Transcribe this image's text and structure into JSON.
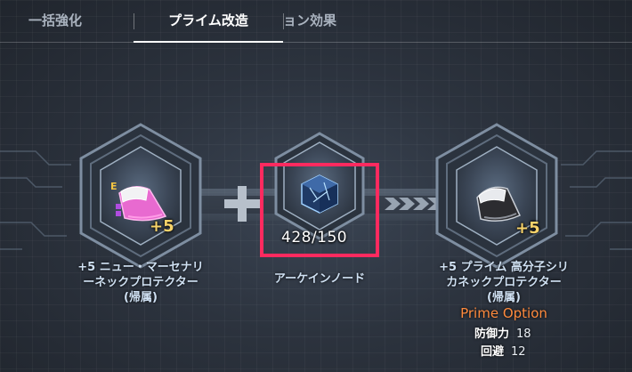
{
  "tabs": [
    {
      "label": "一括強化",
      "active": false
    },
    {
      "label": "プライム改造",
      "active": true
    },
    {
      "label": "ョン効果",
      "active": false
    }
  ],
  "source_item": {
    "plus": "+5",
    "name_lines": [
      "+5 ニュー・マーセナリ",
      "ーネックプロテクター",
      "(帰属)"
    ],
    "grade_letter": "E",
    "icon": "pink-neck-protector-icon"
  },
  "material": {
    "count": "428/150",
    "name": "アーケインノード",
    "icon": "arcane-node-cube-icon"
  },
  "result_item": {
    "plus": "+5",
    "name_lines": [
      "+5 プライム 高分子シリ",
      "カネックプロテクター",
      "(帰属)"
    ],
    "icon": "black-neck-protector-icon"
  },
  "prime_option": {
    "title": "Prime Option",
    "stats": [
      {
        "key": "防御力",
        "value": "18"
      },
      {
        "key": "回避",
        "value": "12"
      }
    ]
  },
  "colors": {
    "accent": "#ff8a3d",
    "plus": "#f7d36a",
    "highlight": "#ff2a5f"
  }
}
